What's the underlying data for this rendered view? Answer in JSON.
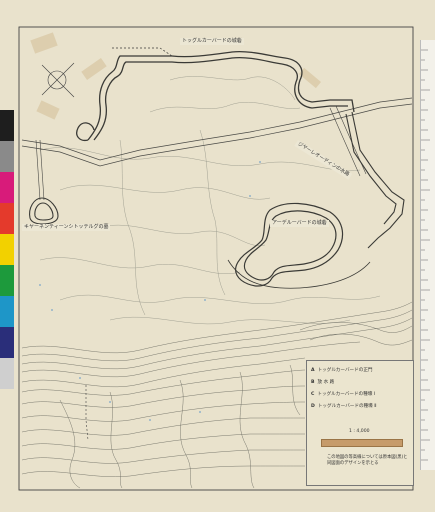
{
  "map": {
    "labels": {
      "north_castle": "トッグルカーバードの城砦",
      "east_castle": "アーデルーバードの城砦",
      "west_castle": "キヤーネンティーンシトッテルグの墓",
      "water_road": "ジヤーレオーディンの水路"
    }
  },
  "legend": {
    "items": [
      {
        "key": "A",
        "text": "トッグルカーバードの正門"
      },
      {
        "key": "B",
        "text": "放 水 路"
      },
      {
        "key": "C",
        "text": "トッグルカーバードの種壕 Ⅰ"
      },
      {
        "key": "D",
        "text": "トッグルカーバードの種壕 Ⅱ"
      }
    ],
    "scale": "1 : 4,000",
    "note": "この地図の等高線については原本図(黒)と同図面のデザインを示とる"
  },
  "colors": {
    "paper": "#e9e2cc",
    "line": "#3f3f3f",
    "swatches": [
      "#1e1e1e",
      "#6b6b6b",
      "#d81b7a",
      "#e43a2c",
      "#f2d100",
      "#1d9a3c",
      "#1e96c8",
      "#2a2e7a",
      "#bfbfbf"
    ]
  }
}
